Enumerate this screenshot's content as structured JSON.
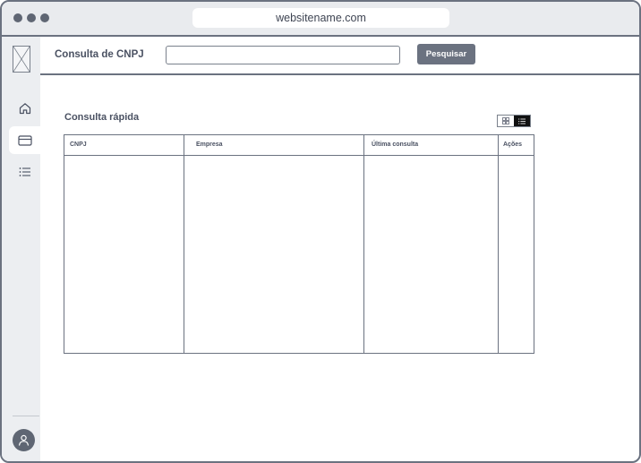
{
  "browser": {
    "url": "websitename.com"
  },
  "header": {
    "title": "Consulta de CNPJ",
    "search": {
      "value": "",
      "placeholder": ""
    },
    "search_button_label": "Pesquisar"
  },
  "sidebar": {
    "items": [
      {
        "icon": "home-icon"
      },
      {
        "icon": "card-icon",
        "active": true
      },
      {
        "icon": "list-icon"
      }
    ],
    "user_icon": "user-icon"
  },
  "main": {
    "section_title": "Consulta rápida",
    "view_toggle": {
      "options": [
        "grid-view-icon",
        "list-view-icon"
      ],
      "selected": "list-view-icon"
    },
    "table": {
      "columns": [
        "CNPJ",
        "Empresa",
        "Última consulta",
        "Ações"
      ],
      "rows": []
    }
  },
  "colors": {
    "accent": "#6b7280",
    "sidebar_bg": "#eceef1",
    "titlebar_bg": "#e9ebee",
    "toggle_selected": "#111111"
  }
}
